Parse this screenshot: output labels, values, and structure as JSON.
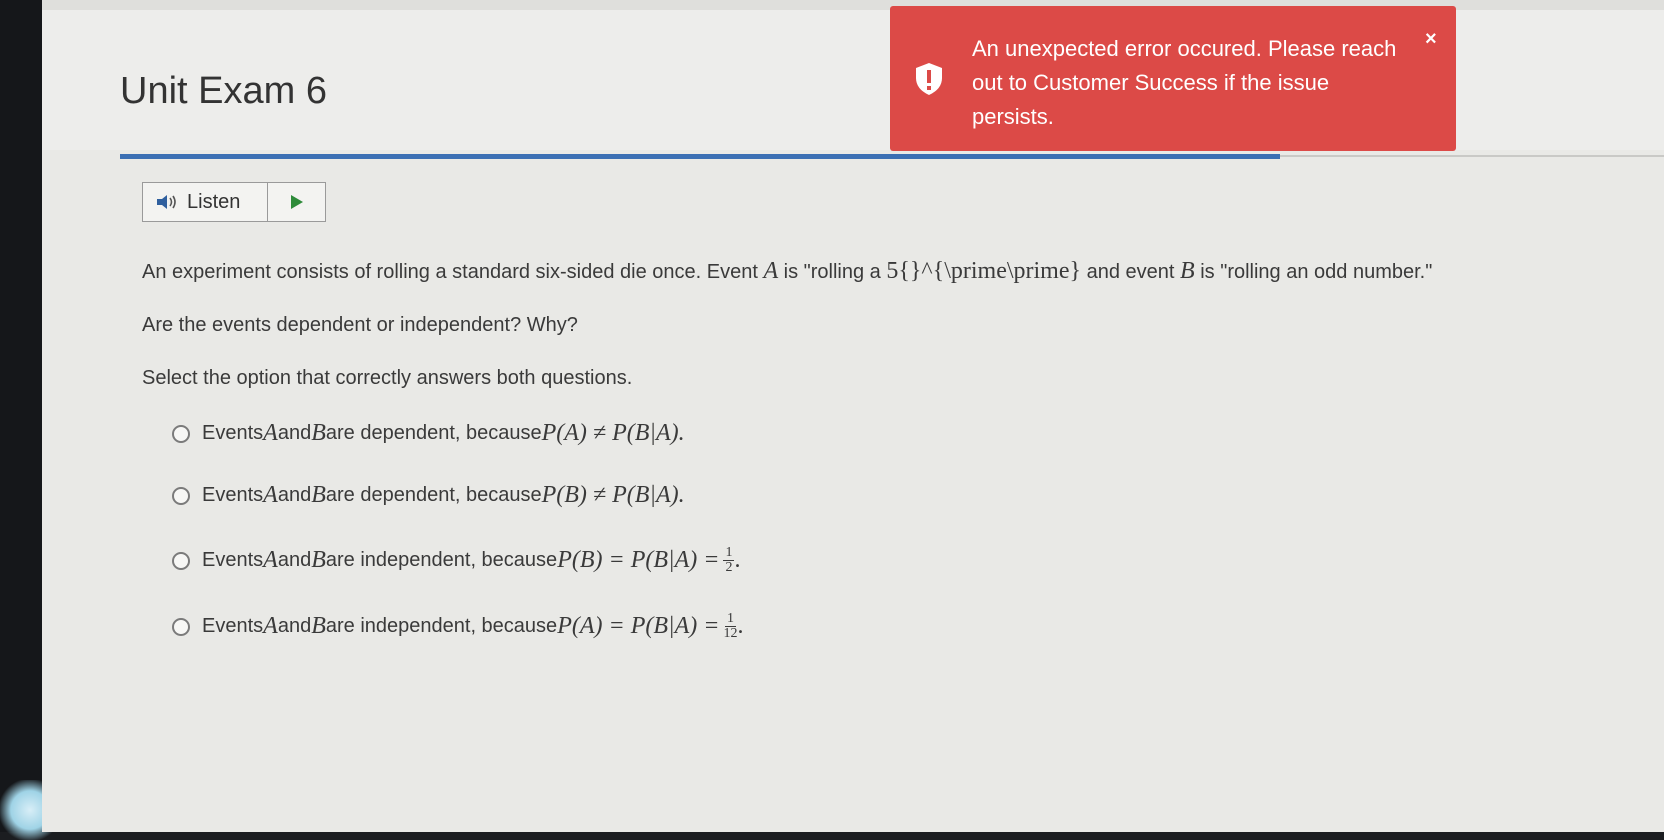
{
  "page": {
    "title": "Unit Exam 6"
  },
  "listen": {
    "label": "Listen"
  },
  "question": {
    "prompt_part1": "An experiment consists of rolling a standard six-sided die once. Event ",
    "var_a": "A",
    "prompt_part2": " is \"rolling a ",
    "prompt_math": "5{}^{\\prime\\prime}",
    "prompt_part3": " and event ",
    "var_b": "B",
    "prompt_part4": " is \"rolling an odd number.\"",
    "line2": "Are the events dependent or independent? Why?",
    "line3": "Select the option that correctly answers both questions."
  },
  "options": [
    {
      "prefix": "Events ",
      "a": "A",
      "and": " and ",
      "b": "B",
      "text": " are dependent, because ",
      "math": "P(A) ≠ P(B|A).",
      "frac_num": "",
      "frac_den": "",
      "suffix": ""
    },
    {
      "prefix": "Events ",
      "a": "A",
      "and": " and ",
      "b": "B",
      "text": " are dependent, because ",
      "math": "P(B) ≠ P(B|A).",
      "frac_num": "",
      "frac_den": "",
      "suffix": ""
    },
    {
      "prefix": "Events ",
      "a": "A",
      "and": " and ",
      "b": "B",
      "text": " are independent, because ",
      "math": "P(B) = P(B|A) = ",
      "frac_num": "1",
      "frac_den": "2",
      "suffix": "."
    },
    {
      "prefix": "Events ",
      "a": "A",
      "and": " and ",
      "b": "B",
      "text": " are independent, because ",
      "math": "P(A) = P(B|A) = ",
      "frac_num": "1",
      "frac_den": "12",
      "suffix": "."
    }
  ],
  "toast": {
    "message": "An unexpected error occured. Please reach out to Customer Success if the issue persists.",
    "close": "×",
    "icon": "alert-shield-icon",
    "color": "#dc4a47"
  },
  "colors": {
    "accent": "#3b6fb3",
    "background": "#e9e9e6"
  }
}
